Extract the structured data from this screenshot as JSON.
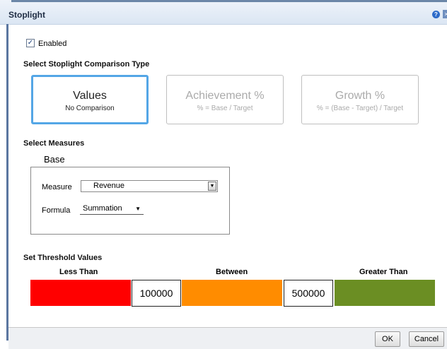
{
  "dialog": {
    "title": "Stoplight",
    "help_icon": "help-icon",
    "close_icon": "close-icon"
  },
  "enabled": {
    "label": "Enabled",
    "checked": true
  },
  "comparison": {
    "heading": "Select Stoplight Comparison Type",
    "options": [
      {
        "label": "Values",
        "subtitle": "No Comparison",
        "selected": true
      },
      {
        "label": "Achievement %",
        "subtitle": "% = Base / Target",
        "selected": false
      },
      {
        "label": "Growth %",
        "subtitle": "% = (Base - Target) / Target",
        "selected": false
      }
    ]
  },
  "measures": {
    "heading": "Select Measures",
    "base_label": "Base",
    "measure_label": "Measure",
    "measure_value": "Revenue",
    "formula_label": "Formula",
    "formula_value": "Summation"
  },
  "thresholds": {
    "heading": "Set Threshold Values",
    "less_than_label": "Less Than",
    "between_label": "Between",
    "greater_than_label": "Greater Than",
    "low_value": "100000",
    "high_value": "500000",
    "colors": {
      "low": "#ff0000",
      "mid": "#ff8c00",
      "high": "#6b8e23"
    }
  },
  "buttons": {
    "ok": "OK",
    "cancel": "Cancel"
  }
}
